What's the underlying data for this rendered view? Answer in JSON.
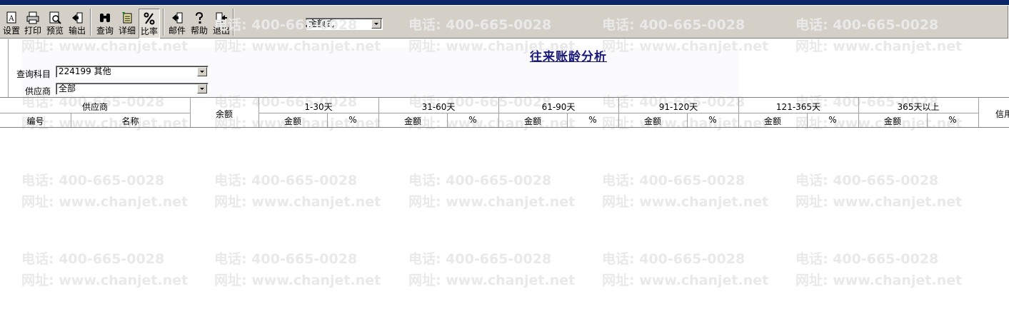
{
  "window": {
    "menu_text": ""
  },
  "toolbar": {
    "buttons": [
      {
        "label": "设置",
        "icon": "page-setup-icon"
      },
      {
        "label": "打印",
        "icon": "printer-icon"
      },
      {
        "label": "预览",
        "icon": "preview-icon"
      },
      {
        "label": "输出",
        "icon": "export-icon"
      },
      {
        "label": "查询",
        "icon": "binoculars-icon"
      },
      {
        "label": "详细",
        "icon": "detail-icon"
      },
      {
        "label": "比率",
        "icon": "percent-icon"
      },
      {
        "label": "邮件",
        "icon": "mail-icon"
      },
      {
        "label": "帮助",
        "icon": "help-icon"
      },
      {
        "label": "退出",
        "icon": "exit-icon"
      }
    ],
    "format_select": {
      "value": "金额式"
    }
  },
  "report": {
    "title": "往来账龄分析",
    "subject_label": "查询科目",
    "subject_value": "224199 其他",
    "supplier_label": "供应商",
    "supplier_value": "全部"
  },
  "grid": {
    "supplier_group": "供应商",
    "code": "编号",
    "name": "名称",
    "balance": "余额",
    "aging_buckets": [
      "1-30天",
      "31-60天",
      "61-90天",
      "91-120天",
      "121-365天",
      "365天以上"
    ],
    "amount": "金额",
    "percent": "%",
    "credit": "信用"
  },
  "watermark": {
    "phone": "电话: 400-665-0028",
    "site": "网址: www.chanjet.net"
  }
}
